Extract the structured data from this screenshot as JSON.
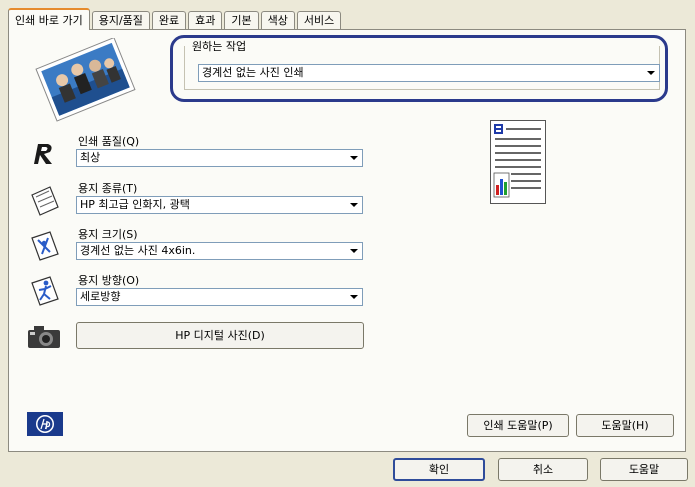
{
  "tabs": [
    {
      "label": "인쇄 바로 가기",
      "active": true
    },
    {
      "label": "용지/품질",
      "active": false
    },
    {
      "label": "완료",
      "active": false
    },
    {
      "label": "효과",
      "active": false
    },
    {
      "label": "기본",
      "active": false
    },
    {
      "label": "색상",
      "active": false
    },
    {
      "label": "서비스",
      "active": false
    }
  ],
  "task": {
    "legend": "원하는 작업",
    "value": "경계선 없는 사진 인쇄"
  },
  "print_quality": {
    "label": "인쇄 품질(Q)",
    "value": "최상"
  },
  "paper_type": {
    "label": "용지 종류(T)",
    "value": "HP 최고급 인화지, 광택"
  },
  "paper_size": {
    "label": "용지 크기(S)",
    "value": "경계선 없는 사진 4x6in."
  },
  "orientation": {
    "label": "용지 방향(O)",
    "value": "세로방향"
  },
  "digital_photo_button": "HP 디지털 사진(D)",
  "print_help_button": "인쇄 도움말(P)",
  "help_panel_button": "도움말(H)",
  "footer": {
    "ok": "확인",
    "cancel": "취소",
    "help": "도움말"
  },
  "icons": {
    "photo_preview": "photo-thumbnail-icon",
    "quality": "printer-quality-icon",
    "paper_type": "paper-sheet-icon",
    "paper_size": "paper-size-icon",
    "orientation": "orientation-figure-icon",
    "camera": "camera-icon",
    "hp": "hp-logo-icon",
    "document": "document-preview-icon"
  },
  "colors": {
    "task_highlight": "#2b3a8c",
    "active_tab_accent": "#e68b2c"
  }
}
